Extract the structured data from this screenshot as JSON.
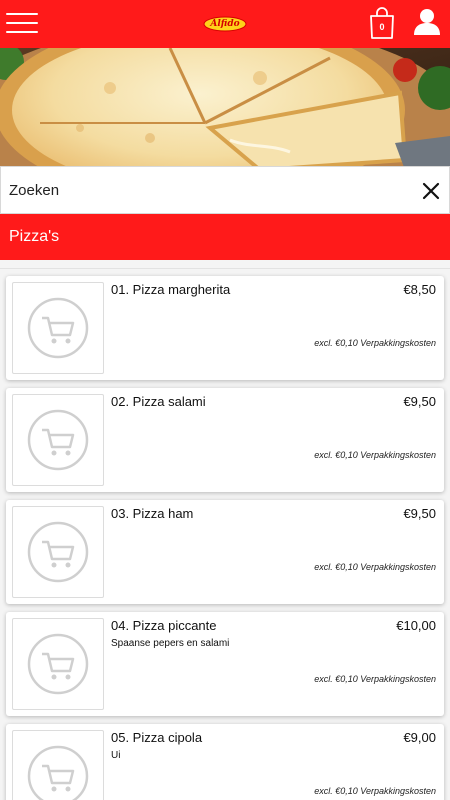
{
  "header": {
    "menu_icon": "hamburger-menu-icon",
    "logo_text": "Alfido",
    "cart_icon": "shopping-bag-icon",
    "cart_count": "0",
    "user_icon": "user-icon",
    "color": "#ff1a1a"
  },
  "hero": {
    "image": "pizza-photo"
  },
  "search": {
    "placeholder": "Zoeken",
    "value": "",
    "clear_icon": "close-icon"
  },
  "category": {
    "title": "Pizza's"
  },
  "products": [
    {
      "name": "01. Pizza margherita",
      "description": "",
      "price": "€8,50",
      "fee": "excl. €0,10 Verpakkingskosten",
      "thumb_icon": "cart-icon"
    },
    {
      "name": "02. Pizza salami",
      "description": "",
      "price": "€9,50",
      "fee": "excl. €0,10 Verpakkingskosten",
      "thumb_icon": "cart-icon"
    },
    {
      "name": "03. Pizza ham",
      "description": "",
      "price": "€9,50",
      "fee": "excl. €0,10 Verpakkingskosten",
      "thumb_icon": "cart-icon"
    },
    {
      "name": "04. Pizza piccante",
      "description": "Spaanse pepers en salami",
      "price": "€10,00",
      "fee": "excl. €0,10 Verpakkingskosten",
      "thumb_icon": "cart-icon"
    },
    {
      "name": "05. Pizza cipola",
      "description": "Ui",
      "price": "€9,00",
      "fee": "excl. €0,10 Verpakkingskosten",
      "thumb_icon": "cart-icon"
    }
  ]
}
